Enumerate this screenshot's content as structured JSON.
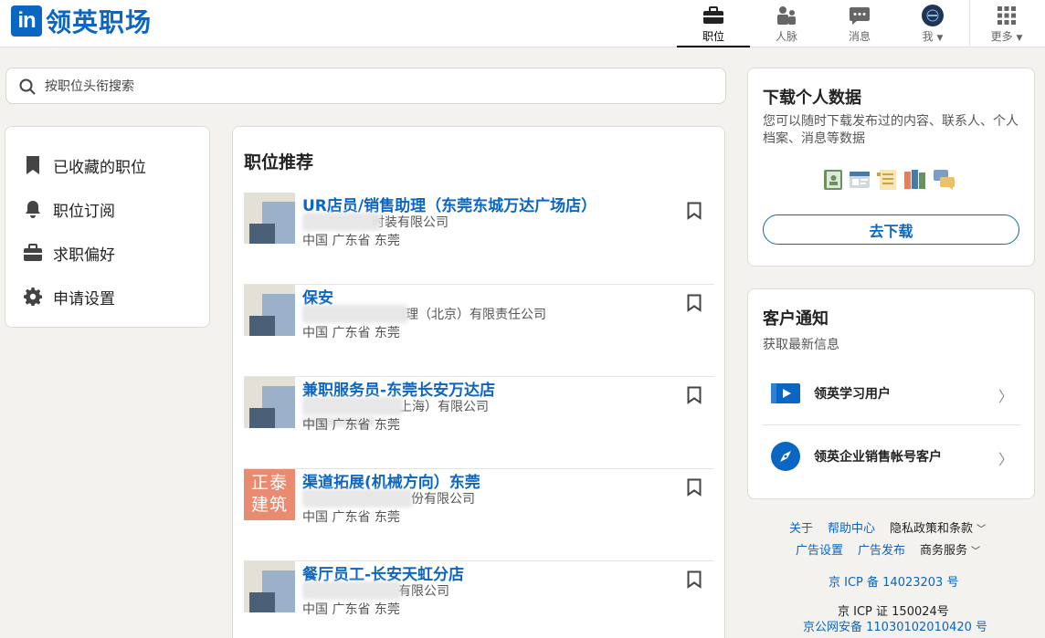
{
  "brand": {
    "logo_in": "in",
    "name": "领英职场"
  },
  "nav": {
    "jobs": "职位",
    "network": "人脉",
    "messages": "消息",
    "me": "我",
    "more": "更多"
  },
  "search": {
    "placeholder": "按职位头衔搜索"
  },
  "sidebar": {
    "items": [
      {
        "label": "已收藏的职位",
        "icon": "bookmark-icon"
      },
      {
        "label": "职位订阅",
        "icon": "bell-icon"
      },
      {
        "label": "求职偏好",
        "icon": "briefcase-icon"
      },
      {
        "label": "申请设置",
        "icon": "gear-icon"
      }
    ]
  },
  "jobs": {
    "title": "职位推荐",
    "items": [
      {
        "title": "UR店员/销售助理（东莞东城万达广场店）",
        "company": "时装有限公司",
        "location": "中国 广东省 东莞"
      },
      {
        "title": "保安",
        "company": "理（北京）有限责任公司",
        "location": "中国 广东省 东莞"
      },
      {
        "title": "兼职服务员-东莞长安万达店",
        "company": "上海）有限公司",
        "location": "中国 广东省 东莞"
      },
      {
        "title": "渠道拓展(机械方向）东莞",
        "company": "份有限公司",
        "location": "中国 广东省 东莞",
        "logo_text": "正泰建筑"
      },
      {
        "title": "餐厅员工-长安天虹分店",
        "company": "有限公司",
        "location": "中国 广东省 东莞"
      }
    ]
  },
  "download": {
    "title": "下载个人数据",
    "desc": "您可以随时下载发布过的内容、联系人、个人档案、消息等数据",
    "button": "去下载"
  },
  "customer": {
    "title": "客户通知",
    "subtitle": "获取最新信息",
    "items": [
      {
        "label": "领英学习用户"
      },
      {
        "label": "领英企业销售帐号客户"
      }
    ]
  },
  "footer": {
    "about": "关于",
    "help": "帮助中心",
    "privacy": "隐私政策和条款",
    "ad_settings": "广告设置",
    "ad_publish": "广告发布",
    "business": "商务服务",
    "icp1": "京 ICP 备 14023203 号",
    "icp2": "京 ICP 证 150024号",
    "icp3": "京公网安备 11030102010420 号"
  },
  "colors": {
    "brand": "#0a66c2",
    "background": "#f3f2ef"
  }
}
